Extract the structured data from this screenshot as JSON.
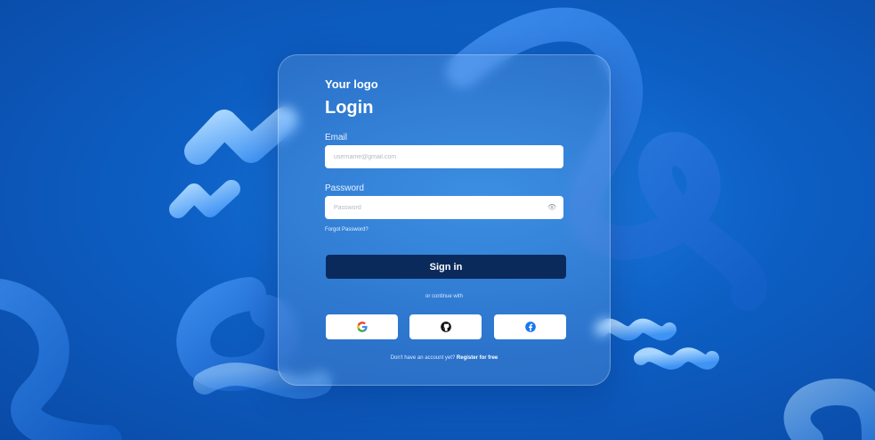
{
  "brand": {
    "logo_text": "Your logo"
  },
  "login": {
    "title": "Login",
    "email_label": "Email",
    "email_placeholder": "username@gmail.com",
    "password_label": "Password",
    "password_placeholder": "Password",
    "forgot_text": "Forgot Password?",
    "signin_label": "Sign in",
    "alt_text": "or continue with",
    "footer_text": "Don't have an account yet?",
    "register_link": "Register for free"
  },
  "social_buttons": [
    {
      "provider": "google",
      "icon": "google-icon"
    },
    {
      "provider": "github",
      "icon": "github-icon"
    },
    {
      "provider": "facebook",
      "icon": "facebook-icon"
    }
  ],
  "colors": {
    "background": "#0d5fc4",
    "button_primary": "#0b2a5c",
    "shape_light": "#6fb6ff",
    "facebook": "#1877f2"
  }
}
